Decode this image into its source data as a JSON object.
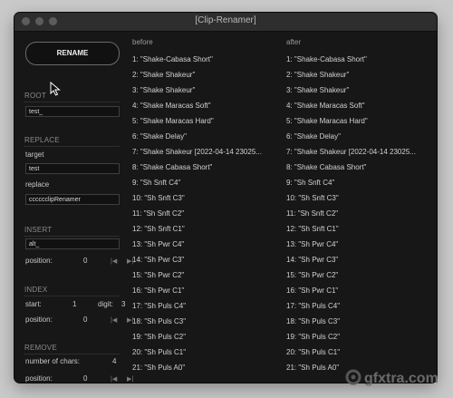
{
  "window": {
    "title": "[Clip-Renamer]"
  },
  "sidebar": {
    "rename_label": "RENAME",
    "root": {
      "heading": "ROOT",
      "value": "test_"
    },
    "replace": {
      "heading": "REPLACE",
      "target_label": "target",
      "target_value": "test",
      "replace_label": "replace",
      "replace_value": "cccccclipRenamer"
    },
    "insert": {
      "heading": "INSERT",
      "value": "alt_",
      "position_label": "position:",
      "position_value": "0"
    },
    "index": {
      "heading": "INDEX",
      "start_label": "start:",
      "start_value": "1",
      "digit_label": "digit:",
      "digit_value": "3",
      "position_label": "position:",
      "position_value": "0"
    },
    "remove": {
      "heading": "REMOVE",
      "chars_label": "number of chars:",
      "chars_value": "4",
      "position_label": "position:",
      "position_value": "0"
    }
  },
  "columns": {
    "before_label": "before",
    "after_label": "after"
  },
  "before": [
    "1: \"Shake-Cabasa Short\"",
    "2: \"Shake Shakeur\"",
    "3: \"Shake Shakeur\"",
    "4: \"Shake Maracas Soft\"",
    "5: \"Shake Maracas Hard\"",
    "6: \"Shake Delay\"",
    "7: \"Shake Shakeur [2022-04-14 23025...",
    "8: \"Shake Cabasa Short\"",
    "9: \"Sh Snft C4\"",
    "10: \"Sh Snft C3\"",
    "11: \"Sh Snft C2\"",
    "12: \"Sh Snft C1\"",
    "13: \"Sh Pwr C4\"",
    "14: \"Sh Pwr C3\"",
    "15: \"Sh Pwr C2\"",
    "16: \"Sh Pwr C1\"",
    "17: \"Sh Puls C4\"",
    "18: \"Sh Puls C3\"",
    "19: \"Sh Puls C2\"",
    "20: \"Sh Puls C1\"",
    "21: \"Sh Puls A0\""
  ],
  "after": [
    "1: \"Shake-Cabasa Short\"",
    "2: \"Shake Shakeur\"",
    "3: \"Shake Shakeur\"",
    "4: \"Shake Maracas Soft\"",
    "5: \"Shake Maracas Hard\"",
    "6: \"Shake Delay\"",
    "7: \"Shake Shakeur [2022-04-14 23025...",
    "8: \"Shake Cabasa Short\"",
    "9: \"Sh Snft C4\"",
    "10: \"Sh Snft C3\"",
    "11: \"Sh Snft C2\"",
    "12: \"Sh Snft C1\"",
    "13: \"Sh Pwr C4\"",
    "14: \"Sh Pwr C3\"",
    "15: \"Sh Pwr C2\"",
    "16: \"Sh Pwr C1\"",
    "17: \"Sh Puls C4\"",
    "18: \"Sh Puls C3\"",
    "19: \"Sh Puls C2\"",
    "20: \"Sh Puls C1\"",
    "21: \"Sh Puls A0\""
  ],
  "watermark": "gfxtra.com",
  "icons": {
    "prev": "step-back-icon",
    "next": "step-forward-icon",
    "cursor": "mouse-pointer-icon"
  }
}
